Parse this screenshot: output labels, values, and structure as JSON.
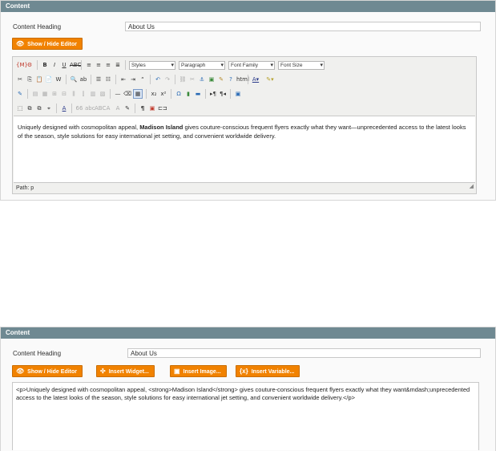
{
  "top_panel": {
    "header": "Content",
    "heading_label": "Content Heading",
    "heading_value": "About Us",
    "show_hide_button": "Show / Hide Editor",
    "styles_select": "Styles",
    "paragraph_select": "Paragraph",
    "font_family_select": "Font Family",
    "font_size_select": "Font Size",
    "body_text_before": "Uniquely designed with cosmopolitan appeal, ",
    "body_text_bold": "Madison Island",
    "body_text_after": " gives couture-conscious frequent flyers exactly what they want—unprecedented access to the latest looks of the season, style solutions for easy international jet setting, and convenient worldwide delivery.",
    "path_label": "Path: p"
  },
  "bottom_panel": {
    "header": "Content",
    "heading_label": "Content Heading",
    "heading_value": "About Us",
    "show_hide_button": "Show / Hide Editor",
    "insert_widget_button": "Insert Widget...",
    "insert_image_button": "Insert Image...",
    "insert_variable_button": "Insert Variable...",
    "code_text": "<p>Uniquely designed with cosmopolitan appeal, <strong>Madison Island</strong> gives couture-conscious frequent flyers exactly what they want&mdash;unprecedented access to the latest looks of the season, style solutions for easy international jet setting, and convenient worldwide delivery.</p>"
  },
  "colors": {
    "header_bg": "#6f8992",
    "button_orange": "#f18200",
    "toolbar_bg": "#f0f0ee"
  }
}
